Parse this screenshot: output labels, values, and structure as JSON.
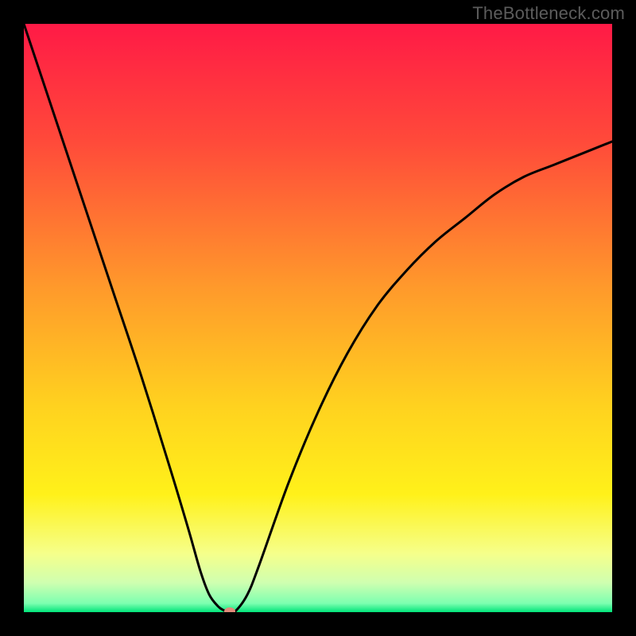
{
  "watermark": "TheBottleneck.com",
  "chart_data": {
    "type": "line",
    "title": "",
    "xlabel": "",
    "ylabel": "",
    "xlim": [
      0,
      100
    ],
    "ylim": [
      0,
      100
    ],
    "grid": false,
    "legend": false,
    "gradient_stops": [
      {
        "offset": 0.0,
        "color": "#ff1a46"
      },
      {
        "offset": 0.2,
        "color": "#ff4a3a"
      },
      {
        "offset": 0.45,
        "color": "#ff9a2b"
      },
      {
        "offset": 0.65,
        "color": "#ffd21f"
      },
      {
        "offset": 0.8,
        "color": "#fff11a"
      },
      {
        "offset": 0.9,
        "color": "#f6ff8a"
      },
      {
        "offset": 0.95,
        "color": "#cfffb0"
      },
      {
        "offset": 0.985,
        "color": "#7dffb0"
      },
      {
        "offset": 1.0,
        "color": "#00e47a"
      }
    ],
    "series": [
      {
        "name": "curve",
        "stroke": "#000000",
        "stroke_width": 3,
        "x": [
          0,
          5,
          10,
          15,
          20,
          25,
          28,
          30,
          31.5,
          33,
          34,
          35,
          36,
          38,
          40,
          45,
          50,
          55,
          60,
          65,
          70,
          75,
          80,
          85,
          90,
          95,
          100
        ],
        "y": [
          100,
          85,
          70,
          55,
          40,
          24,
          14,
          7,
          3,
          1,
          0.3,
          0,
          0.2,
          3,
          8,
          22,
          34,
          44,
          52,
          58,
          63,
          67,
          71,
          74,
          76,
          78,
          80
        ]
      }
    ],
    "marker": {
      "x": 35,
      "y_value": 0,
      "color": "#e28a7a",
      "rx": 7,
      "ry": 5
    }
  }
}
